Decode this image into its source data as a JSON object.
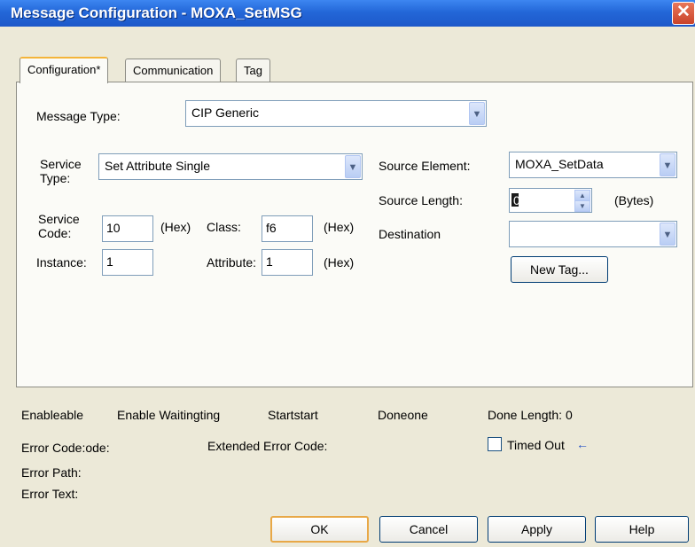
{
  "window": {
    "title": "Message Configuration - MOXA_SetMSG",
    "close_glyph": "✕"
  },
  "tabs": [
    {
      "label": "Configuration*",
      "active": true
    },
    {
      "label": "Communication",
      "active": false
    },
    {
      "label": "Tag",
      "active": false
    }
  ],
  "config": {
    "message_type_label": "Message Type:",
    "message_type_value": "CIP Generic",
    "service_type_label_1": "Service",
    "service_type_label_2": "Type:",
    "service_type_value": "Set Attribute Single",
    "service_code_label_1": "Service",
    "service_code_label_2": "Code:",
    "service_code_value": "10",
    "hex_label": "(Hex)",
    "class_label": "Class:",
    "class_value": "f6",
    "instance_label": "Instance:",
    "instance_value": "1",
    "attribute_label": "Attribute:",
    "attribute_value": "1",
    "source_element_label": "Source Element:",
    "source_element_value": "MOXA_SetData",
    "source_length_label": "Source Length:",
    "source_length_value": "0",
    "bytes_label": "(Bytes)",
    "destination_label": "Destination",
    "destination_value": "",
    "new_tag_label": "New Tag..."
  },
  "status": {
    "enable": "Enableable",
    "enable_waiting": "Enable Waitingting",
    "start": "Startstart",
    "done": "Doneone",
    "done_length": "Done Length: 0",
    "error_code": "Error Code:ode:",
    "extended_error_code": "Extended Error Code:",
    "timed_out": "Timed Out",
    "timed_out_arrow": "←",
    "error_path": "Error Path:",
    "error_text": "Error Text:"
  },
  "buttons": {
    "ok": "OK",
    "cancel": "Cancel",
    "apply": "Apply",
    "help": "Help"
  },
  "icons": {
    "dropdown": "chevron-down-icon",
    "spin_up": "spin-up-icon",
    "spin_down": "spin-down-icon",
    "close": "close-icon",
    "arrow": "arrow-left-icon"
  },
  "colors": {
    "titlebar": "#2367d8",
    "dialog_bg": "#ece9d8",
    "panel_bg": "#fbfbf7",
    "input_border": "#7f9db9",
    "default_button_border": "#e8a847",
    "arrow_blue": "#2a56c6"
  }
}
